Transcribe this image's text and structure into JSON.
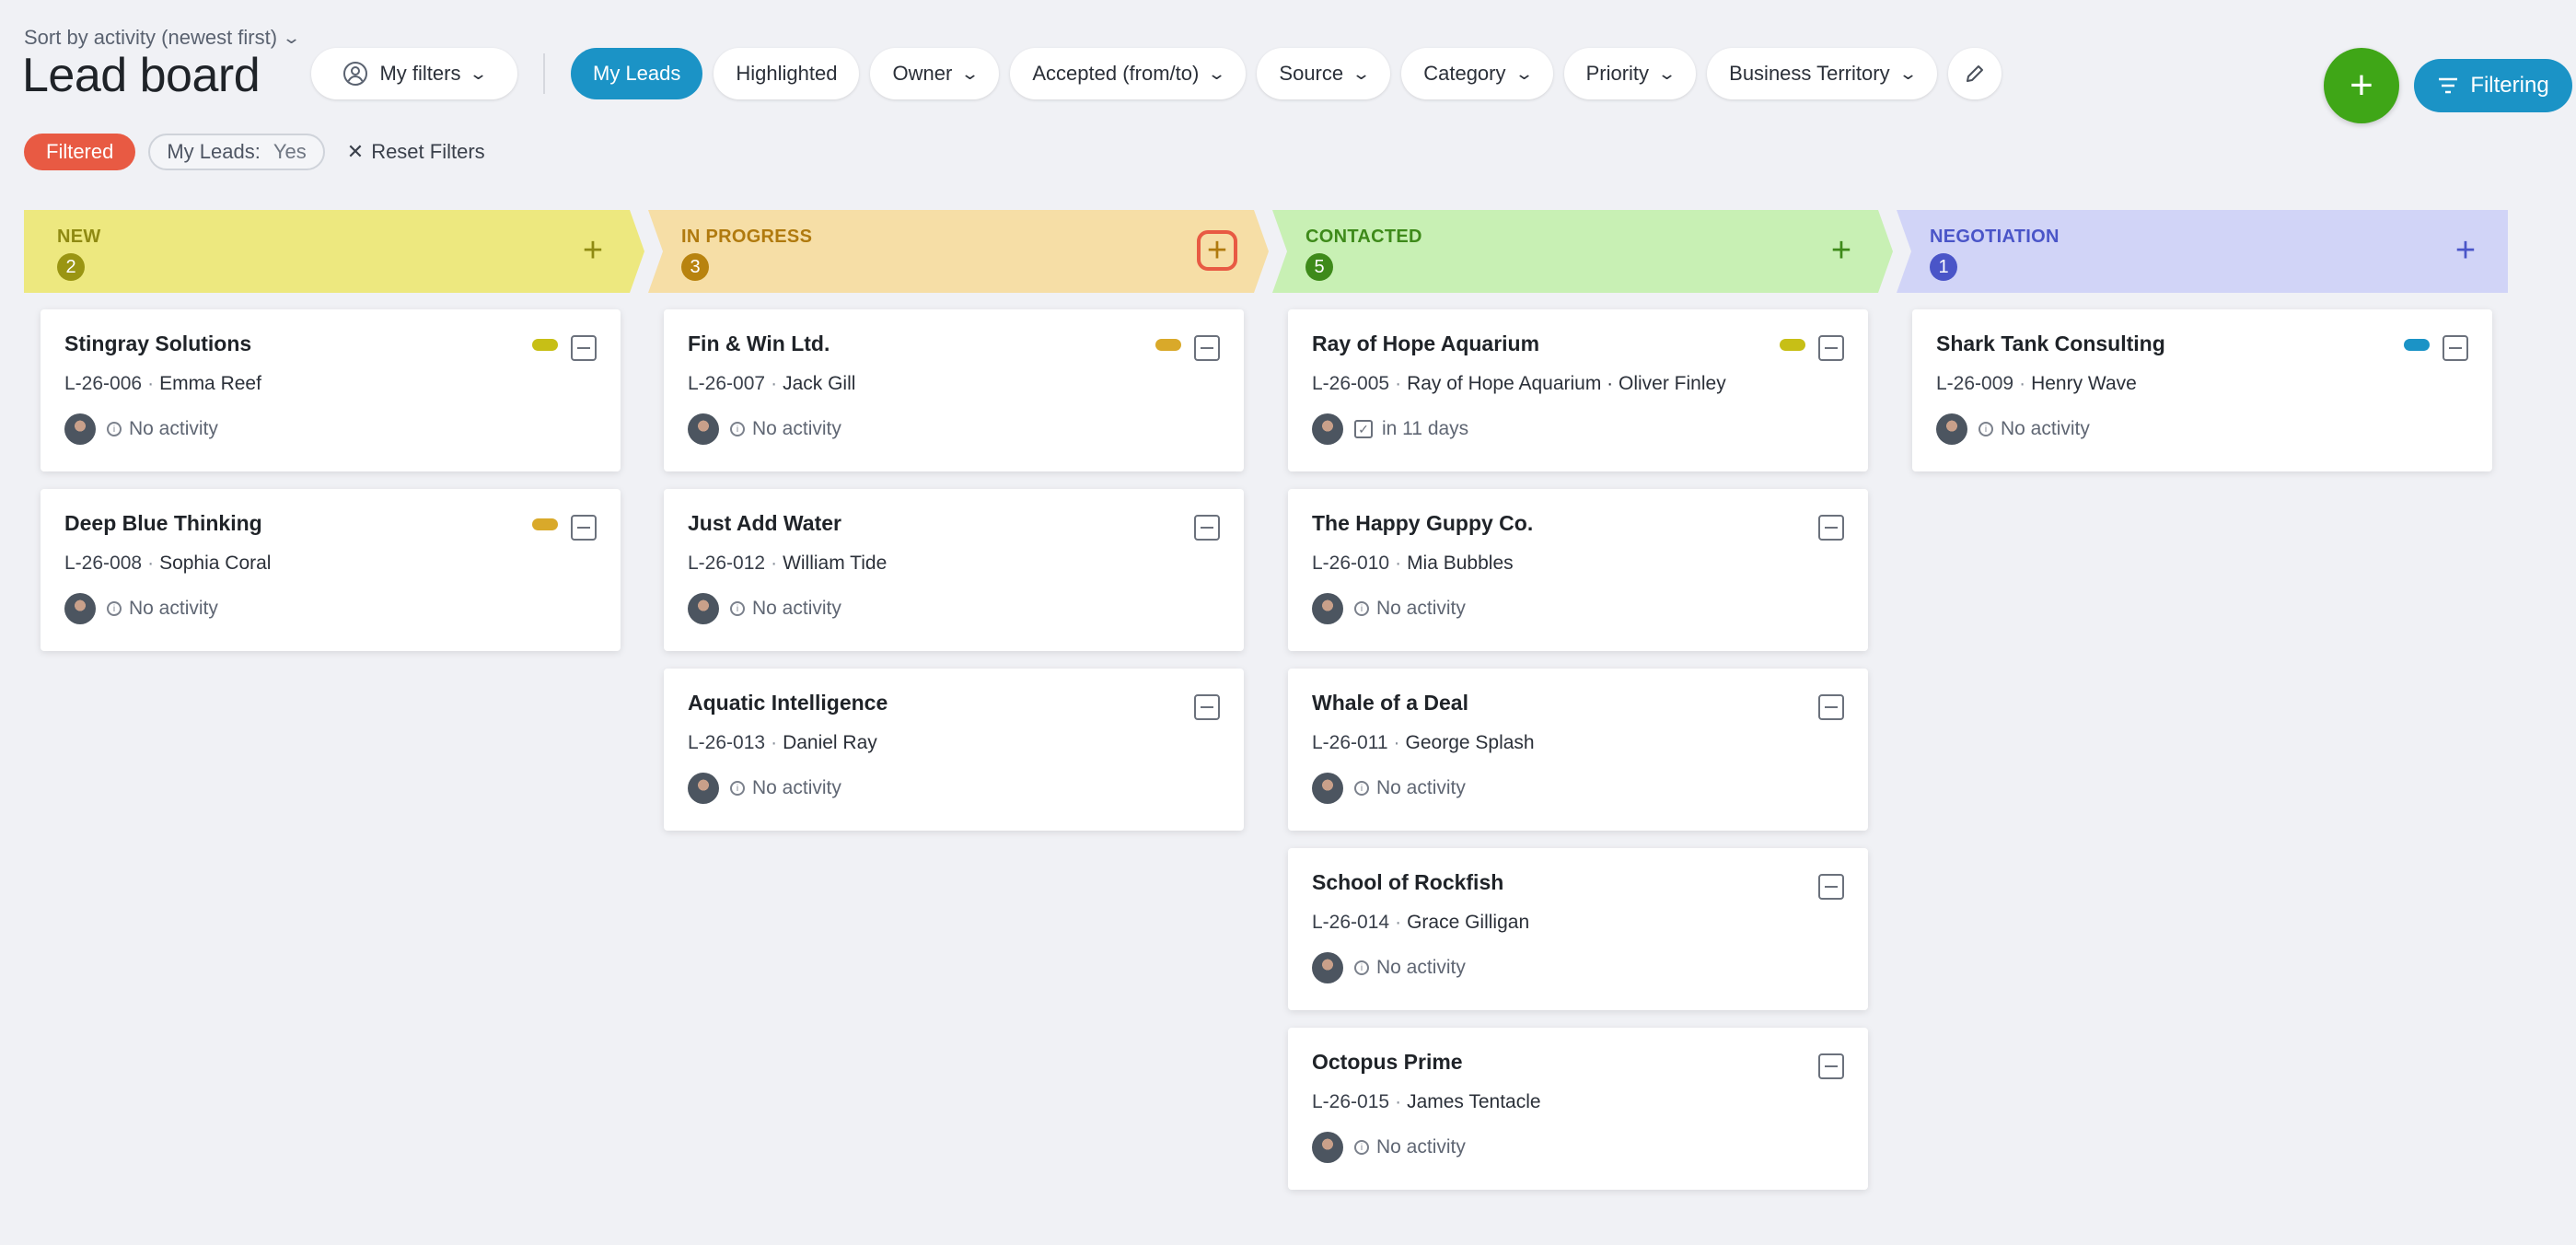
{
  "header": {
    "sort_label": "Sort by activity (newest first)",
    "title": "Lead board",
    "my_filters": "My filters",
    "pills": [
      {
        "label": "My Leads",
        "active": true,
        "dropdown": false
      },
      {
        "label": "Highlighted",
        "active": false,
        "dropdown": false
      },
      {
        "label": "Owner",
        "active": false,
        "dropdown": true
      },
      {
        "label": "Accepted (from/to)",
        "active": false,
        "dropdown": true
      },
      {
        "label": "Source",
        "active": false,
        "dropdown": true
      },
      {
        "label": "Category",
        "active": false,
        "dropdown": true
      },
      {
        "label": "Priority",
        "active": false,
        "dropdown": true
      },
      {
        "label": "Business Territory",
        "active": false,
        "dropdown": true
      }
    ],
    "add_button": "+",
    "filtering_label": "Filtering"
  },
  "filters": {
    "status": "Filtered",
    "chip_key": "My Leads:",
    "chip_value": "Yes",
    "reset_label": "Reset Filters"
  },
  "columns": [
    {
      "name": "NEW",
      "count": "2",
      "bg": "#ede87f",
      "text": "#8f8a12",
      "badge": "#9a9512",
      "cards": [
        {
          "name": "Stingray Solutions",
          "code": "L-26-006",
          "contact": "Emma Reef",
          "activity": "No activity",
          "activity_icon": "clock-icon",
          "tag": "#c7bf16"
        },
        {
          "name": "Deep Blue Thinking",
          "code": "L-26-008",
          "contact": "Sophia Coral",
          "activity": "No activity",
          "activity_icon": "clock-icon",
          "tag": "#d9a92a"
        }
      ]
    },
    {
      "name": "IN PROGRESS",
      "count": "3",
      "bg": "#f6dea6",
      "text": "#b07a0e",
      "badge": "#b8830f",
      "cards": [
        {
          "name": "Fin & Win Ltd.",
          "code": "L-26-007",
          "contact": "Jack Gill",
          "activity": "No activity",
          "activity_icon": "clock-icon",
          "tag": "#d9a92a"
        },
        {
          "name": "Just Add Water",
          "code": "L-26-012",
          "contact": "William Tide",
          "activity": "No activity",
          "activity_icon": "clock-icon",
          "tag": ""
        },
        {
          "name": "Aquatic Intelligence",
          "code": "L-26-013",
          "contact": "Daniel Ray",
          "activity": "No activity",
          "activity_icon": "clock-icon",
          "tag": ""
        }
      ]
    },
    {
      "name": "CONTACTED",
      "count": "5",
      "bg": "#c8f0b4",
      "text": "#3e8a1a",
      "badge": "#3e8a1a",
      "cards": [
        {
          "name": "Ray of Hope Aquarium",
          "code": "L-26-005",
          "contact": "Ray of Hope Aquarium · Oliver Finley",
          "activity": "in 11 days",
          "activity_icon": "checkbox-icon",
          "tag": "#c7bf16"
        },
        {
          "name": "The Happy Guppy Co.",
          "code": "L-26-010",
          "contact": "Mia Bubbles",
          "activity": "No activity",
          "activity_icon": "clock-icon",
          "tag": ""
        },
        {
          "name": "Whale of a Deal",
          "code": "L-26-011",
          "contact": "George Splash",
          "activity": "No activity",
          "activity_icon": "clock-icon",
          "tag": ""
        },
        {
          "name": "School of Rockfish",
          "code": "L-26-014",
          "contact": "Grace Gilligan",
          "activity": "No activity",
          "activity_icon": "clock-icon",
          "tag": ""
        },
        {
          "name": "Octopus Prime",
          "code": "L-26-015",
          "contact": "James Tentacle",
          "activity": "No activity",
          "activity_icon": "clock-icon",
          "tag": ""
        }
      ]
    },
    {
      "name": "NEGOTIATION",
      "count": "1",
      "bg": "#d1d4f7",
      "text": "#4a55c8",
      "badge": "#4a55c8",
      "cards": [
        {
          "name": "Shark Tank Consulting",
          "code": "L-26-009",
          "contact": "Henry Wave",
          "activity": "No activity",
          "activity_icon": "clock-icon",
          "tag": "#1b93c6"
        }
      ]
    }
  ]
}
